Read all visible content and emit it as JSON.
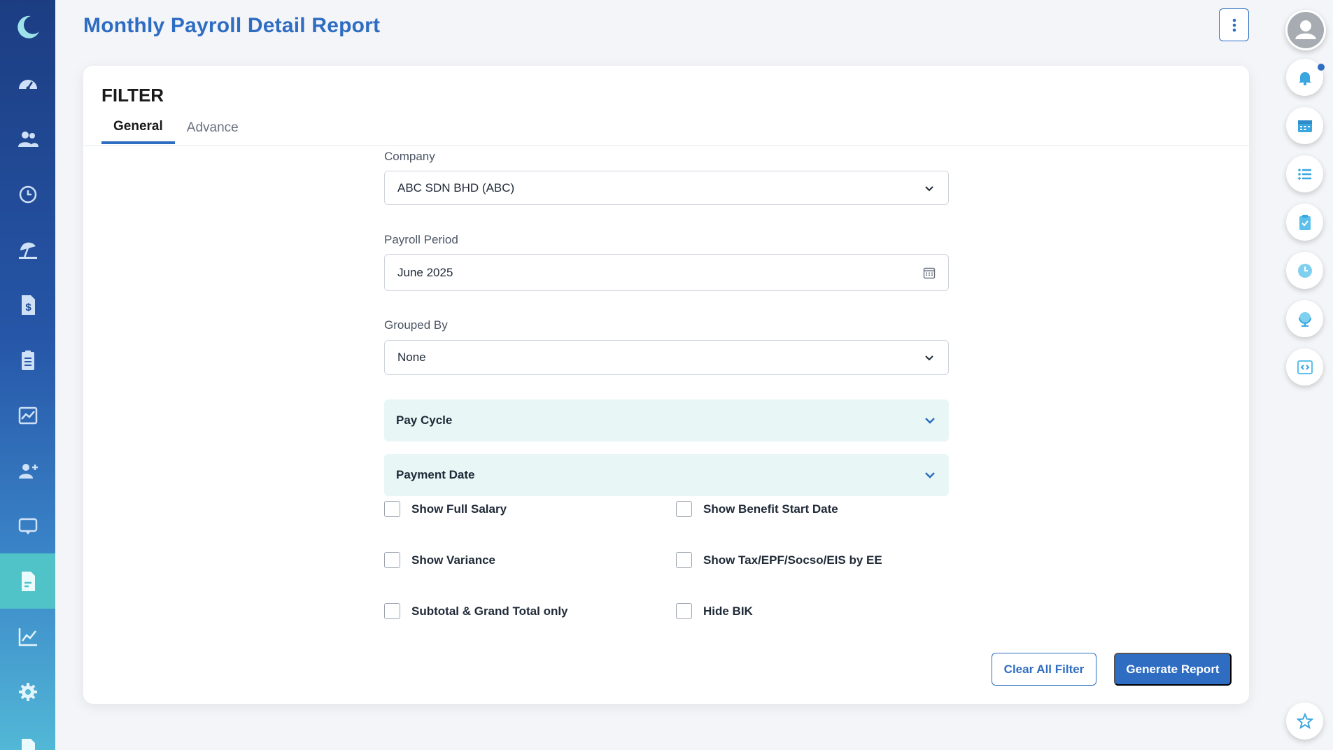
{
  "header": {
    "title": "Monthly Payroll Detail Report"
  },
  "sidebar": {
    "items": [
      {
        "icon": "dashboard-icon"
      },
      {
        "icon": "employees-icon"
      },
      {
        "icon": "history-icon"
      },
      {
        "icon": "leave-icon"
      },
      {
        "icon": "payroll-icon"
      },
      {
        "icon": "claims-icon"
      },
      {
        "icon": "analytics-icon"
      },
      {
        "icon": "add-user-icon"
      },
      {
        "icon": "presentation-icon"
      },
      {
        "icon": "reports-icon",
        "active": true
      },
      {
        "icon": "chart-icon"
      },
      {
        "icon": "settings-icon"
      },
      {
        "icon": "document-icon"
      }
    ]
  },
  "filter": {
    "title": "FILTER",
    "tabs": [
      {
        "label": "General",
        "active": true
      },
      {
        "label": "Advance",
        "active": false
      }
    ],
    "company": {
      "label": "Company",
      "value": "ABC SDN BHD (ABC)"
    },
    "payroll_period": {
      "label": "Payroll Period",
      "value": "June 2025"
    },
    "grouped_by": {
      "label": "Grouped By",
      "value": "None"
    },
    "accordions": [
      {
        "label": "Pay Cycle"
      },
      {
        "label": "Payment Date"
      }
    ],
    "checkboxes": [
      {
        "label": "Show Full Salary",
        "checked": false
      },
      {
        "label": "Show Benefit Start Date",
        "checked": false
      },
      {
        "label": "Show Variance",
        "checked": false
      },
      {
        "label": "Show Tax/EPF/Socso/EIS by EE",
        "checked": false
      },
      {
        "label": "Subtotal & Grand Total only",
        "checked": false
      },
      {
        "label": "Hide BIK",
        "checked": false
      }
    ],
    "buttons": {
      "clear": "Clear All Filter",
      "generate": "Generate Report"
    }
  },
  "right_rail": {
    "items": [
      {
        "icon": "bell-icon"
      },
      {
        "icon": "calendar-icon"
      },
      {
        "icon": "list-icon"
      },
      {
        "icon": "clipboard-check-icon"
      },
      {
        "icon": "clock-icon"
      },
      {
        "icon": "globe-icon"
      },
      {
        "icon": "code-icon"
      },
      {
        "icon": "star-icon"
      }
    ]
  },
  "colors": {
    "primary": "#2e6dc2",
    "accent_teal": "#4fc3c8",
    "accordion_bg": "#e8f6f6"
  }
}
